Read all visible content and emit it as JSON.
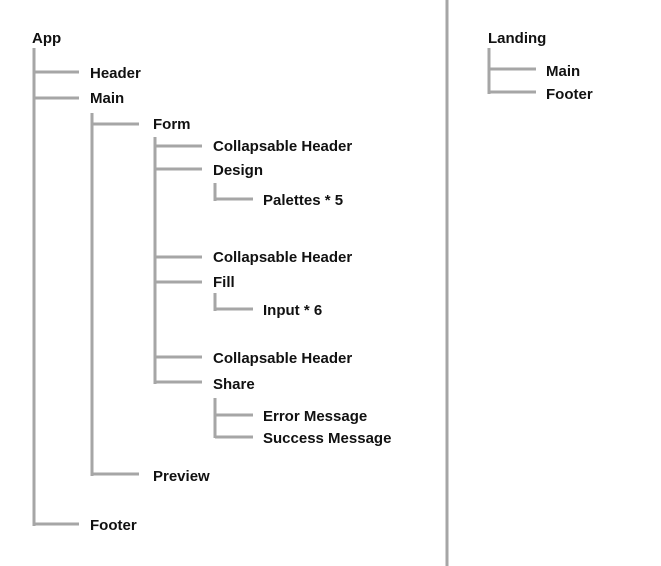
{
  "tree": {
    "app": "App",
    "header": "Header",
    "main": "Main",
    "form": "Form",
    "collapsable_header_1": "Collapsable Header",
    "design": "Design",
    "palettes": "Palettes * 5",
    "collapsable_header_2": "Collapsable Header",
    "fill": "Fill",
    "input": "Input * 6",
    "collapsable_header_3": "Collapsable Header",
    "share": "Share",
    "error_message": "Error Message",
    "success_message": "Success Message",
    "preview": "Preview",
    "footer": "Footer"
  },
  "landing_tree": {
    "landing": "Landing",
    "main": "Main",
    "footer": "Footer"
  },
  "colors": {
    "line": "#a6a6a6",
    "text": "#111111",
    "background": "#ffffff"
  }
}
